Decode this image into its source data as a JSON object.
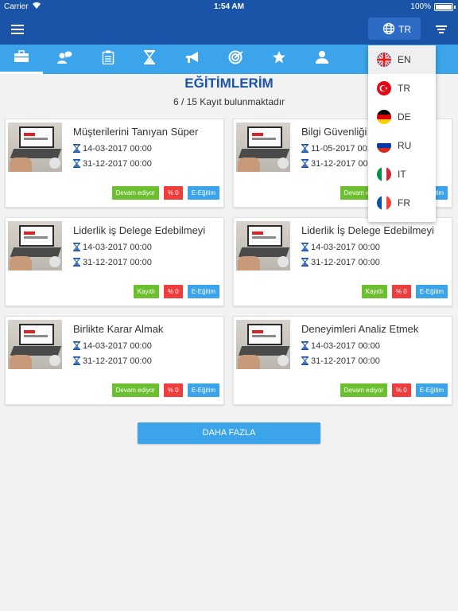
{
  "status_bar": {
    "carrier": "Carrier",
    "time": "1:54 AM",
    "battery": "100%",
    "battery_level": 1.0
  },
  "navbar": {
    "menu_icon": "hamburger-menu-icon",
    "language_button_label": "TR",
    "language_icon": "globe-icon",
    "filter_icon": "filter-icon"
  },
  "tabs": [
    {
      "icon": "briefcase-icon",
      "active": true
    },
    {
      "icon": "user-chat-icon",
      "active": false
    },
    {
      "icon": "clipboard-icon",
      "active": false
    },
    {
      "icon": "hourglass-icon",
      "active": false
    },
    {
      "icon": "megaphone-icon",
      "active": false
    },
    {
      "icon": "target-icon",
      "active": false
    },
    {
      "icon": "star-icon",
      "active": false
    },
    {
      "icon": "user-certificate-icon",
      "active": false
    }
  ],
  "page": {
    "title": "EĞİTİMLERİM",
    "record_count": "6 / 15 Kayıt bulunmaktadır"
  },
  "courses": [
    {
      "title": "Müşterilerini Tanıyan Süper",
      "start": "14-03-2017 00:00",
      "end": "31-12-2017 00:00",
      "status": "Devam ediyor",
      "status_color": "#6cbf2e",
      "progress": "% 0",
      "type": "E-Eğitim"
    },
    {
      "title": "Bilgi Güvenliği",
      "start": "11-05-2017 00:00",
      "end": "31-12-2017 00:00",
      "status": "Devam ediyor",
      "status_color": "#6cbf2e",
      "progress": "% 0",
      "type": "E-Eğitim"
    },
    {
      "title": "Liderlik iş Delege Edebilmeyi",
      "start": "14-03-2017 00:00",
      "end": "31-12-2017 00:00",
      "status": "Kayıtlı",
      "status_color": "#6cbf2e",
      "progress": "% 0",
      "type": "E-Eğitim"
    },
    {
      "title": "Liderlik İş Delege Edebilmeyi",
      "start": "14-03-2017 00:00",
      "end": "31-12-2017 00:00",
      "status": "Kayıtlı",
      "status_color": "#6cbf2e",
      "progress": "% 0",
      "type": "E-Eğitim"
    },
    {
      "title": "Birlikte Karar Almak",
      "start": "14-03-2017 00:00",
      "end": "31-12-2017 00:00",
      "status": "Devam ediyor",
      "status_color": "#6cbf2e",
      "progress": "% 0",
      "type": "E-Eğitim"
    },
    {
      "title": "Deneyimleri Analiz Etmek",
      "start": "14-03-2017 00:00",
      "end": "31-12-2017 00:00",
      "status": "Devam ediyor",
      "status_color": "#6cbf2e",
      "progress": "% 0",
      "type": "E-Eğitim"
    }
  ],
  "more_button": "DAHA FAZLA",
  "language_menu": {
    "items": [
      {
        "code": "EN",
        "flag": "uk-flag-icon",
        "selected": true
      },
      {
        "code": "TR",
        "flag": "turkey-flag-icon",
        "selected": false
      },
      {
        "code": "DE",
        "flag": "germany-flag-icon",
        "selected": false
      },
      {
        "code": "RU",
        "flag": "russia-flag-icon",
        "selected": false
      },
      {
        "code": "IT",
        "flag": "italy-flag-icon",
        "selected": false
      },
      {
        "code": "FR",
        "flag": "france-flag-icon",
        "selected": false
      }
    ]
  },
  "colors": {
    "primary": "#1a54a8",
    "accent": "#3ba4ea",
    "green": "#6cbf2e",
    "red": "#ef3d3d"
  }
}
